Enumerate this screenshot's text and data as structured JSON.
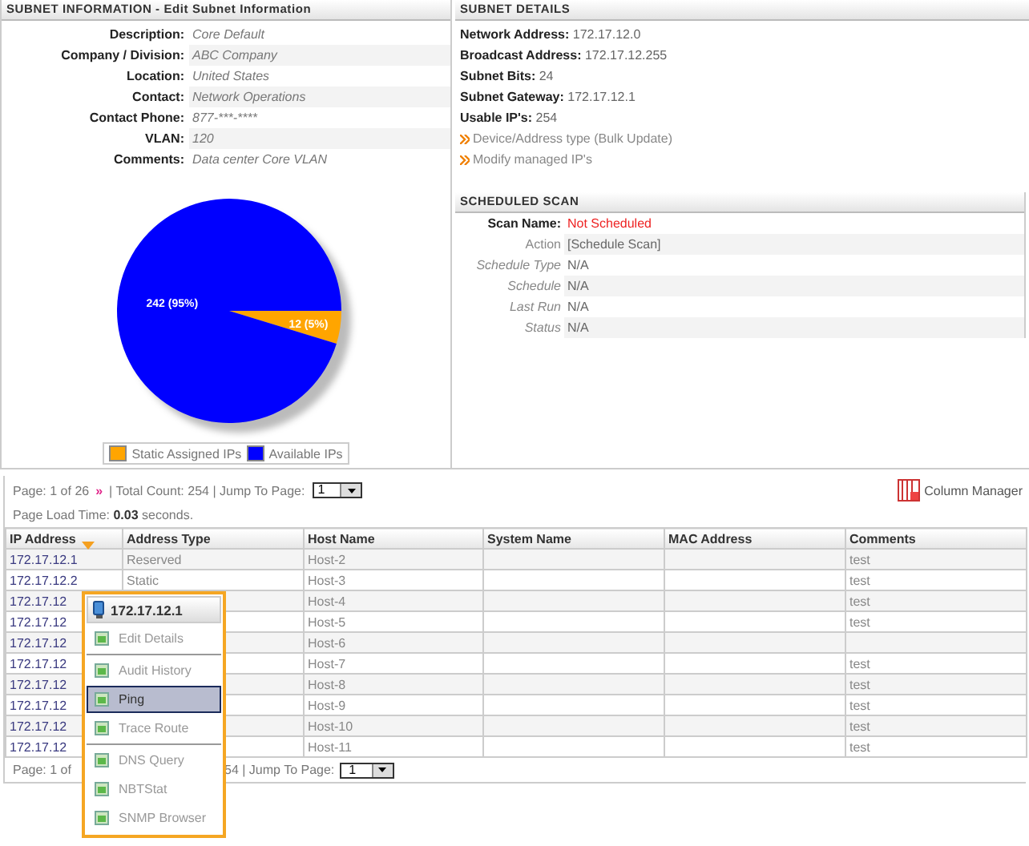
{
  "subnet_information": {
    "title": "SUBNET INFORMATION - Edit Subnet Information",
    "fields": [
      {
        "label": "Description:",
        "value": "Core Default"
      },
      {
        "label": "Company / Division:",
        "value": "ABC Company"
      },
      {
        "label": "Location:",
        "value": "United States"
      },
      {
        "label": "Contact:",
        "value": "Network Operations"
      },
      {
        "label": "Contact Phone:",
        "value": "877-***-****"
      },
      {
        "label": "VLAN:",
        "value": "120"
      },
      {
        "label": "Comments:",
        "value": "Data center Core VLAN"
      }
    ],
    "chart_data": {
      "type": "pie",
      "categories": [
        "Static Assigned IPs",
        "Available IPs"
      ],
      "values": [
        12,
        242
      ],
      "colors": [
        "#ffa500",
        "#0000ff"
      ],
      "value_labels": [
        "12 (5%)",
        "242 (95%)"
      ]
    }
  },
  "subnet_details": {
    "title": "SUBNET DETAILS",
    "fields": [
      {
        "label": "Network Address:",
        "value": "172.17.12.0"
      },
      {
        "label": "Broadcast Address:",
        "value": "172.17.12.255"
      },
      {
        "label": "Subnet Bits:",
        "value": "24"
      },
      {
        "label": "Subnet Gateway:",
        "value": "172.17.12.1"
      },
      {
        "label": "Usable IP's:",
        "value": "254"
      }
    ],
    "links": [
      "Device/Address type (Bulk Update)",
      "Modify managed IP's"
    ]
  },
  "scheduled_scan": {
    "title": "SCHEDULED SCAN",
    "rows": [
      {
        "kind": "name",
        "label": "Scan Name:",
        "value": "Not Scheduled"
      },
      {
        "kind": "action",
        "label": "Action",
        "value": "[Schedule Scan]"
      },
      {
        "kind": "field",
        "label": "Schedule Type",
        "value": "N/A"
      },
      {
        "kind": "field",
        "label": "Schedule",
        "value": "N/A"
      },
      {
        "kind": "field",
        "label": "Last Run",
        "value": "N/A"
      },
      {
        "kind": "field",
        "label": "Status",
        "value": "N/A"
      }
    ]
  },
  "pager_top": {
    "page": "Page: 1 of 26",
    "next": "»",
    "count": "| Total Count: 254 | Jump To Page:",
    "jump": "1",
    "column_manager": "Column Manager",
    "load_time": "Page Load Time: **0.03** seconds."
  },
  "table": {
    "columns": [
      {
        "label": "IP Address",
        "sorted": true
      },
      {
        "label": "Address Type",
        "sorted": false
      },
      {
        "label": "Host Name",
        "sorted": false
      },
      {
        "label": "System Name",
        "sorted": false
      },
      {
        "label": "MAC Address",
        "sorted": false
      },
      {
        "label": "Comments",
        "sorted": false
      }
    ],
    "rows": [
      [
        "172.17.12.1",
        "Reserved",
        "Host-2",
        "",
        "",
        "test"
      ],
      [
        "172.17.12.2",
        "Static",
        "Host-3",
        "",
        "",
        "test"
      ],
      [
        "172.17.12",
        "",
        "Host-4",
        "",
        "",
        "test"
      ],
      [
        "172.17.12",
        "",
        "Host-5",
        "",
        "",
        "test"
      ],
      [
        "172.17.12",
        "",
        "Host-6",
        "",
        "",
        ""
      ],
      [
        "172.17.12",
        "",
        "Host-7",
        "",
        "",
        "test"
      ],
      [
        "172.17.12",
        "",
        "Host-8",
        "",
        "",
        "test"
      ],
      [
        "172.17.12",
        "",
        "Host-9",
        "",
        "",
        "test"
      ],
      [
        "172.17.12",
        "",
        "Host-10",
        "",
        "",
        "test"
      ],
      [
        "172.17.12",
        "",
        "Host-11",
        "",
        "",
        "test"
      ]
    ]
  },
  "pager_bottom": {
    "left": "Page: 1 of",
    "right": "54 | Jump To Page:",
    "jump": "1"
  },
  "context_menu": {
    "title": "172.17.12.1",
    "groups": [
      {
        "items": [
          {
            "label": "Edit Details",
            "selected": false
          }
        ]
      },
      {
        "items": [
          {
            "label": "Audit History",
            "selected": false
          },
          {
            "label": "Ping",
            "selected": true
          },
          {
            "label": "Trace Route",
            "selected": false
          }
        ]
      },
      {
        "items": [
          {
            "label": "DNS Query",
            "selected": false
          },
          {
            "label": "NBTStat",
            "selected": false
          },
          {
            "label": "SNMP Browser",
            "selected": false
          }
        ]
      }
    ]
  }
}
